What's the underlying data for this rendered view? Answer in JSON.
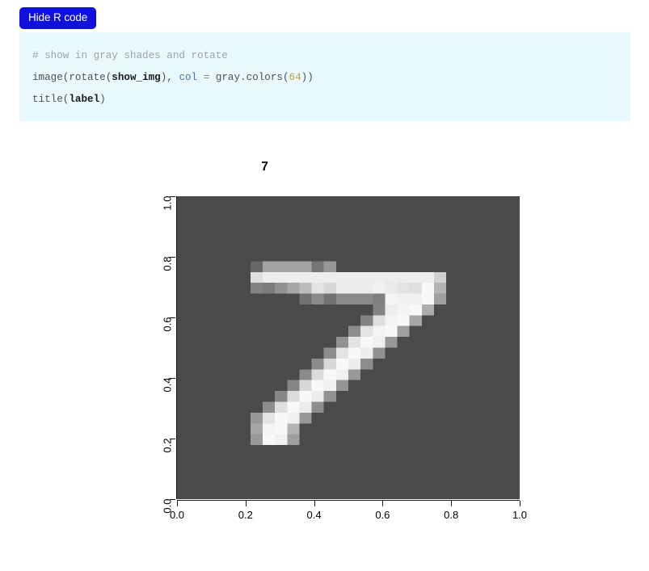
{
  "toolbar": {
    "code_toggle_label": "Hide R code"
  },
  "code_block": {
    "language": "r",
    "lines": [
      {
        "tokens": [
          {
            "text": "# show in gray shades and rotate",
            "type": "comment"
          }
        ]
      },
      {
        "tokens": [
          {
            "text": "image",
            "type": "fn"
          },
          {
            "text": "(",
            "type": "punct"
          },
          {
            "text": "rotate",
            "type": "fn"
          },
          {
            "text": "(",
            "type": "punct"
          },
          {
            "text": "show_img",
            "type": "var"
          },
          {
            "text": "), ",
            "type": "punct"
          },
          {
            "text": "col",
            "type": "arg"
          },
          {
            "text": " = ",
            "type": "op"
          },
          {
            "text": "gray.colors",
            "type": "fn"
          },
          {
            "text": "(",
            "type": "punct"
          },
          {
            "text": "64",
            "type": "num"
          },
          {
            "text": "))",
            "type": "punct"
          }
        ]
      },
      {
        "tokens": [
          {
            "text": "title",
            "type": "fn"
          },
          {
            "text": "(",
            "type": "punct"
          },
          {
            "text": "label",
            "type": "var"
          },
          {
            "text": ")",
            "type": "punct"
          }
        ]
      }
    ]
  },
  "plot": {
    "title": "7",
    "background_color": "#4a4a4a",
    "colormap": "gray.colors(64)",
    "x_ticks": [
      "0.0",
      "0.2",
      "0.4",
      "0.6",
      "0.8",
      "1.0"
    ],
    "y_ticks": [
      "0.0",
      "0.2",
      "0.4",
      "0.6",
      "0.8",
      "1.0"
    ],
    "xlim": [
      0,
      1
    ],
    "ylim": [
      0,
      1
    ],
    "xlabel": "",
    "ylabel": ""
  },
  "chart_data": {
    "type": "heatmap",
    "title": "7",
    "xlabel": "",
    "ylabel": "",
    "xlim": [
      0,
      1
    ],
    "ylim": [
      0,
      1
    ],
    "x_tick_labels": [
      "0.0",
      "0.2",
      "0.4",
      "0.6",
      "0.8",
      "1.0"
    ],
    "y_tick_labels": [
      "0.0",
      "0.2",
      "0.4",
      "0.6",
      "0.8",
      "1.0"
    ],
    "grid": false,
    "legend": "none",
    "colormap": "gray",
    "value_range": [
      0,
      255
    ],
    "rows": 28,
    "cols": 28,
    "description": "MNIST handwritten digit 7, 28x28 grayscale pixel intensities rendered on a dark gray canvas",
    "values": [
      [
        0,
        0,
        0,
        0,
        0,
        0,
        0,
        0,
        0,
        0,
        0,
        0,
        0,
        0,
        0,
        0,
        0,
        0,
        0,
        0,
        0,
        0,
        0,
        0,
        0,
        0,
        0,
        0
      ],
      [
        0,
        0,
        0,
        0,
        0,
        0,
        0,
        0,
        0,
        0,
        0,
        0,
        0,
        0,
        0,
        0,
        0,
        0,
        0,
        0,
        0,
        0,
        0,
        0,
        0,
        0,
        0,
        0
      ],
      [
        0,
        0,
        0,
        0,
        0,
        0,
        0,
        0,
        0,
        0,
        0,
        0,
        0,
        0,
        0,
        0,
        0,
        0,
        0,
        0,
        0,
        0,
        0,
        0,
        0,
        0,
        0,
        0
      ],
      [
        0,
        0,
        0,
        0,
        0,
        0,
        0,
        0,
        0,
        0,
        0,
        0,
        0,
        0,
        0,
        0,
        0,
        0,
        0,
        0,
        0,
        0,
        0,
        0,
        0,
        0,
        0,
        0
      ],
      [
        0,
        0,
        0,
        0,
        0,
        0,
        0,
        0,
        0,
        0,
        0,
        0,
        0,
        0,
        0,
        0,
        0,
        0,
        0,
        0,
        0,
        0,
        0,
        0,
        0,
        0,
        0,
        0
      ],
      [
        0,
        0,
        0,
        0,
        0,
        0,
        0,
        0,
        0,
        0,
        0,
        0,
        0,
        0,
        0,
        0,
        0,
        0,
        0,
        0,
        0,
        0,
        0,
        0,
        0,
        0,
        0,
        0
      ],
      [
        0,
        0,
        0,
        0,
        0,
        0,
        40,
        125,
        125,
        125,
        125,
        60,
        110,
        0,
        0,
        0,
        0,
        0,
        0,
        0,
        0,
        0,
        0,
        0,
        0,
        0,
        0,
        0
      ],
      [
        0,
        0,
        0,
        0,
        0,
        0,
        210,
        230,
        230,
        230,
        230,
        230,
        230,
        230,
        230,
        230,
        230,
        230,
        230,
        230,
        230,
        190,
        0,
        0,
        0,
        0,
        0,
        0
      ],
      [
        0,
        0,
        0,
        0,
        0,
        0,
        80,
        70,
        100,
        130,
        160,
        215,
        200,
        230,
        230,
        230,
        235,
        225,
        215,
        210,
        245,
        150,
        0,
        0,
        0,
        0,
        0,
        0
      ],
      [
        0,
        0,
        0,
        0,
        0,
        0,
        0,
        0,
        0,
        0,
        55,
        90,
        55,
        90,
        90,
        90,
        75,
        240,
        235,
        235,
        245,
        120,
        0,
        0,
        0,
        0,
        0,
        0
      ],
      [
        0,
        0,
        0,
        0,
        0,
        0,
        0,
        0,
        0,
        0,
        0,
        0,
        0,
        0,
        0,
        0,
        80,
        230,
        240,
        245,
        140,
        0,
        0,
        0,
        0,
        0,
        0,
        0
      ],
      [
        0,
        0,
        0,
        0,
        0,
        0,
        0,
        0,
        0,
        0,
        0,
        0,
        0,
        0,
        0,
        80,
        210,
        240,
        245,
        130,
        0,
        0,
        0,
        0,
        0,
        0,
        0,
        0
      ],
      [
        0,
        0,
        0,
        0,
        0,
        0,
        0,
        0,
        0,
        0,
        0,
        0,
        0,
        0,
        95,
        215,
        240,
        245,
        120,
        0,
        0,
        0,
        0,
        0,
        0,
        0,
        0,
        0
      ],
      [
        0,
        0,
        0,
        0,
        0,
        0,
        0,
        0,
        0,
        0,
        0,
        0,
        0,
        100,
        215,
        245,
        235,
        110,
        0,
        0,
        0,
        0,
        0,
        0,
        0,
        0,
        0,
        0
      ],
      [
        0,
        0,
        0,
        0,
        0,
        0,
        0,
        0,
        0,
        0,
        0,
        0,
        95,
        215,
        245,
        230,
        100,
        0,
        0,
        0,
        0,
        0,
        0,
        0,
        0,
        0,
        0,
        0
      ],
      [
        0,
        0,
        0,
        0,
        0,
        0,
        0,
        0,
        0,
        0,
        0,
        90,
        200,
        245,
        230,
        95,
        0,
        0,
        0,
        0,
        0,
        0,
        0,
        0,
        0,
        0,
        0,
        0
      ],
      [
        0,
        0,
        0,
        0,
        0,
        0,
        0,
        0,
        0,
        0,
        90,
        205,
        245,
        235,
        110,
        0,
        0,
        0,
        0,
        0,
        0,
        0,
        0,
        0,
        0,
        0,
        0,
        0
      ],
      [
        0,
        0,
        0,
        0,
        0,
        0,
        0,
        0,
        0,
        85,
        200,
        245,
        235,
        105,
        0,
        0,
        0,
        0,
        0,
        0,
        0,
        0,
        0,
        0,
        0,
        0,
        0,
        0
      ],
      [
        0,
        0,
        0,
        0,
        0,
        0,
        0,
        0,
        85,
        205,
        245,
        230,
        100,
        0,
        0,
        0,
        0,
        0,
        0,
        0,
        0,
        0,
        0,
        0,
        0,
        0,
        0,
        0
      ],
      [
        0,
        0,
        0,
        0,
        0,
        0,
        0,
        95,
        210,
        245,
        230,
        95,
        0,
        0,
        0,
        0,
        0,
        0,
        0,
        0,
        0,
        0,
        0,
        0,
        0,
        0,
        0,
        0
      ],
      [
        0,
        0,
        0,
        0,
        0,
        0,
        110,
        215,
        245,
        235,
        110,
        0,
        0,
        0,
        0,
        0,
        0,
        0,
        0,
        0,
        0,
        0,
        0,
        0,
        0,
        0,
        0,
        0
      ],
      [
        0,
        0,
        0,
        0,
        0,
        0,
        130,
        240,
        245,
        150,
        0,
        0,
        0,
        0,
        0,
        0,
        0,
        0,
        0,
        0,
        0,
        0,
        0,
        0,
        0,
        0,
        0,
        0
      ],
      [
        0,
        0,
        0,
        0,
        0,
        0,
        110,
        245,
        235,
        120,
        0,
        0,
        0,
        0,
        0,
        0,
        0,
        0,
        0,
        0,
        0,
        0,
        0,
        0,
        0,
        0,
        0,
        0
      ],
      [
        0,
        0,
        0,
        0,
        0,
        0,
        0,
        0,
        0,
        0,
        0,
        0,
        0,
        0,
        0,
        0,
        0,
        0,
        0,
        0,
        0,
        0,
        0,
        0,
        0,
        0,
        0,
        0
      ],
      [
        0,
        0,
        0,
        0,
        0,
        0,
        0,
        0,
        0,
        0,
        0,
        0,
        0,
        0,
        0,
        0,
        0,
        0,
        0,
        0,
        0,
        0,
        0,
        0,
        0,
        0,
        0,
        0
      ],
      [
        0,
        0,
        0,
        0,
        0,
        0,
        0,
        0,
        0,
        0,
        0,
        0,
        0,
        0,
        0,
        0,
        0,
        0,
        0,
        0,
        0,
        0,
        0,
        0,
        0,
        0,
        0,
        0
      ],
      [
        0,
        0,
        0,
        0,
        0,
        0,
        0,
        0,
        0,
        0,
        0,
        0,
        0,
        0,
        0,
        0,
        0,
        0,
        0,
        0,
        0,
        0,
        0,
        0,
        0,
        0,
        0,
        0
      ],
      [
        0,
        0,
        0,
        0,
        0,
        0,
        0,
        0,
        0,
        0,
        0,
        0,
        0,
        0,
        0,
        0,
        0,
        0,
        0,
        0,
        0,
        0,
        0,
        0,
        0,
        0,
        0,
        0
      ]
    ]
  }
}
